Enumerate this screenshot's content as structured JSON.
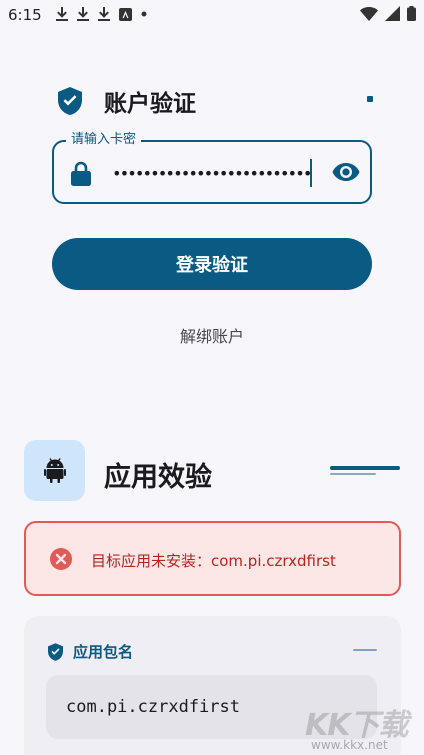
{
  "status_bar": {
    "time": "6:15",
    "icons_left": [
      "download-icon",
      "download-icon",
      "download-icon",
      "app-badge-icon",
      "dot-icon"
    ],
    "icons_right": [
      "wifi-icon",
      "signal-icon",
      "battery-icon"
    ]
  },
  "account": {
    "title": "账户验证",
    "password_label": "请输入卡密",
    "password_value": "••••••••••••••••••••••••••••",
    "login_button": "登录验证",
    "unbind_link": "解绑账户"
  },
  "app_check": {
    "title": "应用效验",
    "error_message": "目标应用未安装：com.pi.czrxdfirst",
    "package_section_title": "应用包名",
    "package_name": "com.pi.czrxdfirst"
  },
  "watermark": {
    "main": "KK下载",
    "sub": "www.kkx.net"
  },
  "colors": {
    "primary": "#0a5a83",
    "error": "#b3261e",
    "error_bg": "#fde6e6",
    "background": "#f7f6fb"
  }
}
